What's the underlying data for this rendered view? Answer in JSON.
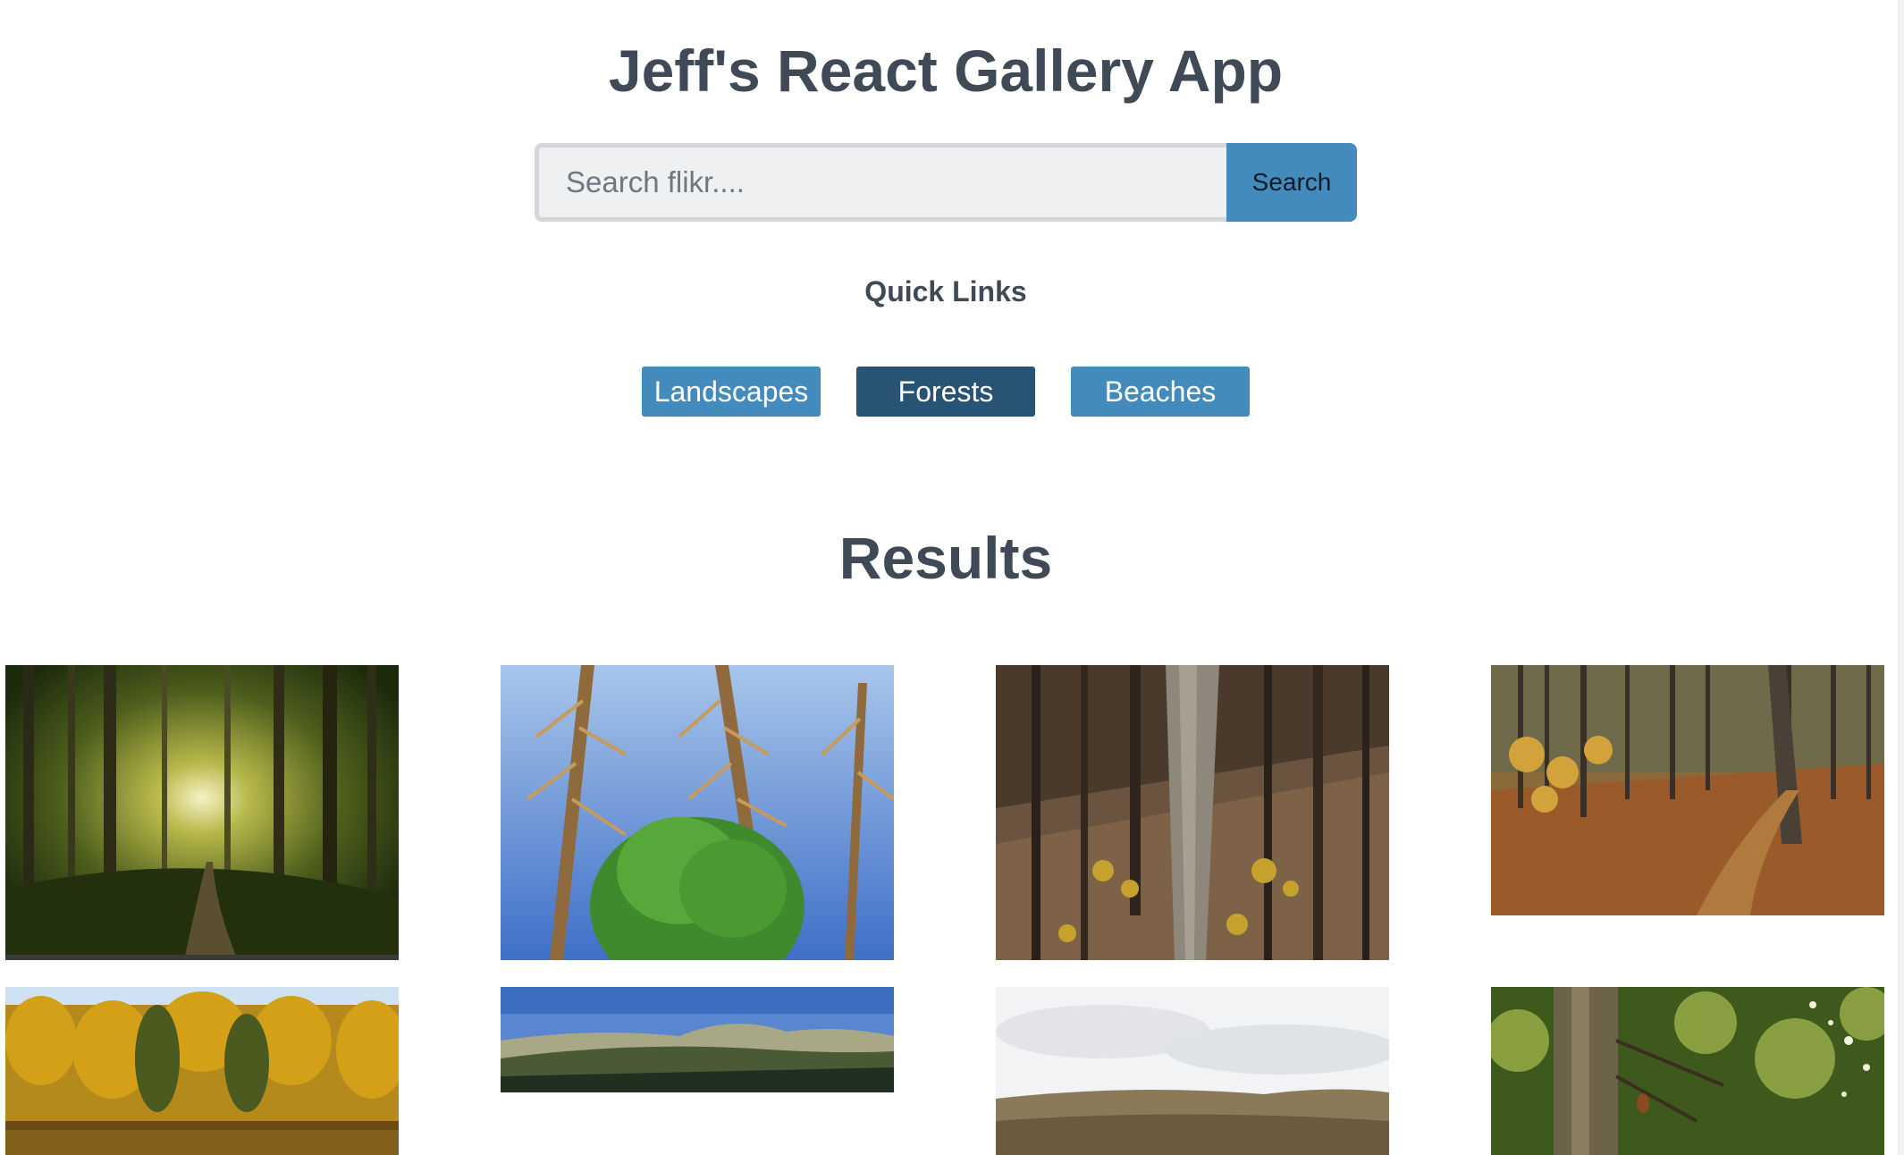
{
  "app": {
    "title": "Jeff's React Gallery App"
  },
  "search": {
    "placeholder": "Search flikr....",
    "value": "",
    "button_label": "Search"
  },
  "quick_links": {
    "heading": "Quick Links",
    "items": [
      {
        "label": "Landscapes",
        "active": false
      },
      {
        "label": "Forests",
        "active": true
      },
      {
        "label": "Beaches",
        "active": false
      }
    ]
  },
  "results": {
    "heading": "Results",
    "photos": [
      {
        "subject": "sunlit green forest path"
      },
      {
        "subject": "tall spruce trees against blue sky"
      },
      {
        "subject": "brown hillside forest with tree trunks"
      },
      {
        "subject": "autumn forest floor with fallen leaves"
      },
      {
        "subject": "golden autumn forest by a lake"
      },
      {
        "subject": "panoramic wooded hills"
      },
      {
        "subject": "hazy hills under cloudy sky"
      },
      {
        "subject": "tree trunk in green forest"
      }
    ]
  },
  "colors": {
    "text": "#3f4a56",
    "accent": "#438bbd",
    "active": "#275374",
    "input_bg": "#eef0f2"
  }
}
